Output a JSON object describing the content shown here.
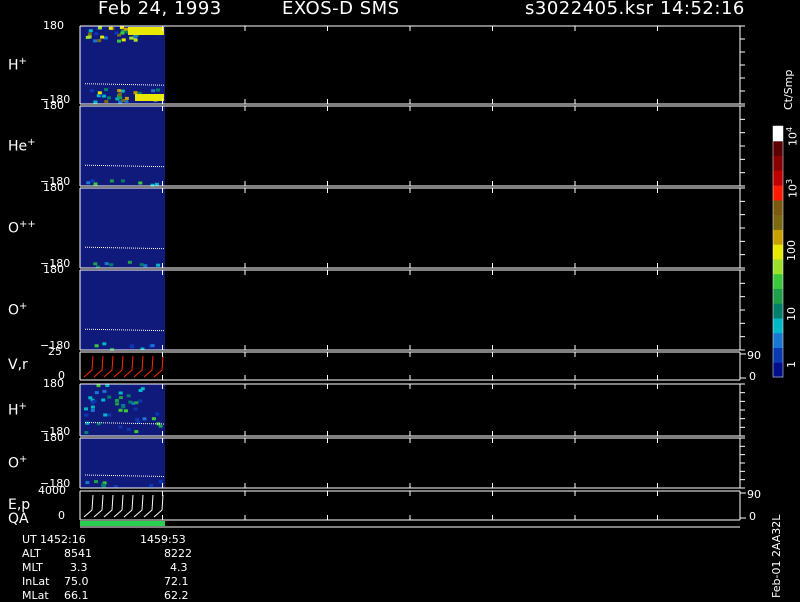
{
  "header": {
    "date": "Feb 24, 1993",
    "instrument": "EXOS-D SMS",
    "file": "s3022405.ksr",
    "time": "14:52:16"
  },
  "colorbar": {
    "unit": "Ct/Smp",
    "ticks": [
      "1",
      "10",
      "100",
      "10",
      "10"
    ],
    "exponents": [
      "",
      "",
      "",
      "3",
      "4"
    ],
    "colors": [
      "#000e8c",
      "#0a39b3",
      "#1976d2",
      "#00b8c8",
      "#00806a",
      "#1ea04a",
      "#3cc83c",
      "#9ce02a",
      "#e8e800",
      "#c8a000",
      "#7c6a12",
      "#7a5a10",
      "#ff1a00",
      "#c00000",
      "#8a0000",
      "#5a0000",
      "#ffffff"
    ]
  },
  "panels": [
    {
      "label": "H",
      "sup": "+",
      "top": "180",
      "bottom": "−180"
    },
    {
      "label": "He",
      "sup": "+",
      "top": "180",
      "bottom": "−180"
    },
    {
      "label": "O",
      "sup": "++",
      "top": "180",
      "bottom": "−180"
    },
    {
      "label": "O",
      "sup": "+",
      "top": "180",
      "bottom": "−180"
    },
    {
      "label": "V,r",
      "sup": "",
      "top": "25",
      "bottom": "0",
      "right_top": "90",
      "right_bottom": "0"
    },
    {
      "label": "H",
      "sup": "+",
      "top": "180",
      "bottom": "−180"
    },
    {
      "label": "O",
      "sup": "+",
      "top": "180",
      "bottom": "−180"
    },
    {
      "label": "E,p",
      "sup": "",
      "label2": "QA",
      "top": "4000",
      "bottom": "0",
      "right_top": "90",
      "right_bottom": "0"
    }
  ],
  "footer": {
    "rows": [
      {
        "name": "UT",
        "v1": "1452:16",
        "v2": "1459:53"
      },
      {
        "name": "ALT",
        "v1": "8541",
        "v2": "8222"
      },
      {
        "name": "MLT",
        "v1": "3.3",
        "v2": "4.3"
      },
      {
        "name": "InLat",
        "v1": "75.0",
        "v2": "72.1"
      },
      {
        "name": "MLat",
        "v1": "66.1",
        "v2": "62.2"
      }
    ],
    "code": "Feb-01 2AA32L"
  },
  "chart_data": {
    "type": "heatmap",
    "title": "Feb 24, 1993   EXOS-D SMS",
    "x": {
      "start": "1452:16",
      "end": "1459:53"
    },
    "colorscale": {
      "unit": "Ct/Smp",
      "scale": "log",
      "range": [
        1,
        10000
      ]
    },
    "panels": [
      "H+",
      "He+",
      "O++",
      "O+",
      "V,r",
      "H+",
      "O+",
      "E,p QA"
    ]
  }
}
